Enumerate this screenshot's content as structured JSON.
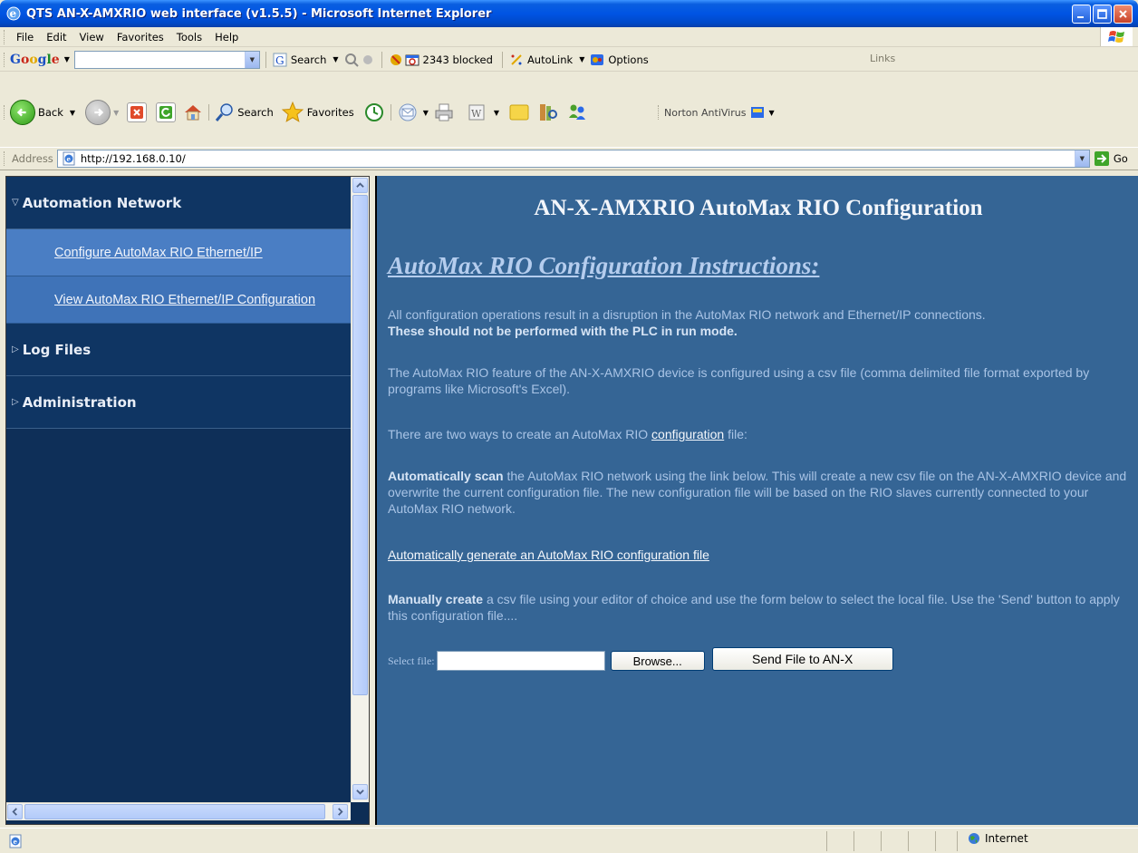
{
  "window": {
    "title": "QTS AN-X-AMXRIO web interface (v1.5.5) - Microsoft Internet Explorer"
  },
  "menubar": {
    "items": [
      "File",
      "Edit",
      "View",
      "Favorites",
      "Tools",
      "Help"
    ]
  },
  "google_toolbar": {
    "logo": [
      "G",
      "o",
      "o",
      "g",
      "l",
      "e"
    ],
    "search_label": "Search",
    "blocked_label": "2343 blocked",
    "autolink_label": "AutoLink",
    "options_label": "Options",
    "links_label": "Links"
  },
  "std_toolbar": {
    "back_label": "Back",
    "search_label": "Search",
    "favorites_label": "Favorites",
    "norton_label": "Norton AntiVirus"
  },
  "address_bar": {
    "label": "Address",
    "url": "http://192.168.0.10/",
    "go_label": "Go"
  },
  "nav": {
    "sections": [
      {
        "label": "Automation Network",
        "expanded": true
      },
      {
        "label": "Log Files",
        "expanded": false
      },
      {
        "label": "Administration",
        "expanded": false
      }
    ],
    "sub_items": [
      "Configure AutoMax RIO Ethernet/IP",
      "View AutoMax RIO Ethernet/IP Configuration"
    ]
  },
  "main": {
    "title": "AN-X-AMXRIO AutoMax RIO Configuration",
    "instructions_heading": "AutoMax RIO Configuration Instructions:",
    "para1_text": "All configuration operations result in a disruption in the AutoMax RIO network and Ethernet/IP connections.",
    "para1_bold": "These should not be performed with the PLC in run mode.",
    "para2": "The AutoMax RIO feature of the AN-X-AMXRIO device is configured using a csv file (comma delimited file format exported by programs like Microsoft's Excel).",
    "para3_pre": "There are two ways to create an AutoMax RIO ",
    "para3_link": "configuration",
    "para3_post": " file:",
    "para4_bold": "Automatically scan",
    "para4_text": " the AutoMax RIO network using the link below. This will create a new csv file on the AN-X-AMXRIO device and overwrite the current configuration file. The new configuration file will be based on the RIO slaves currently connected to your AutoMax RIO network.",
    "generate_link": "Automatically generate an AutoMax RIO configuration file",
    "para5_bold": "Manually create",
    "para5_text": " a csv file using your editor of choice and use the form below to select the local file. Use the 'Send' button to apply this configuration file....",
    "form": {
      "select_label": "Select file:",
      "file_value": "",
      "browse_label": "Browse...",
      "send_label": "Send File to AN-X"
    }
  },
  "statusbar": {
    "zone": "Internet"
  }
}
